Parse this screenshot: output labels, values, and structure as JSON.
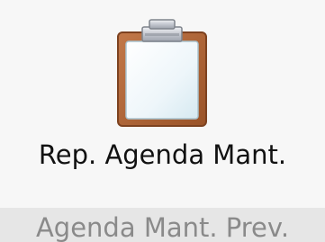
{
  "ribbon": {
    "button": {
      "icon": "clipboard-icon",
      "label": "Rep. Agenda Mant."
    },
    "group_label": "Agenda Mant. Prev."
  },
  "colors": {
    "background": "#f7f7f7",
    "group_bar": "#e6e6e6",
    "label_text": "#111111",
    "group_text": "#8a8a8a",
    "clipboard_wood": "#b0673a",
    "clip_metal": "#c8ccd4",
    "paper": "#eaf4f8"
  }
}
